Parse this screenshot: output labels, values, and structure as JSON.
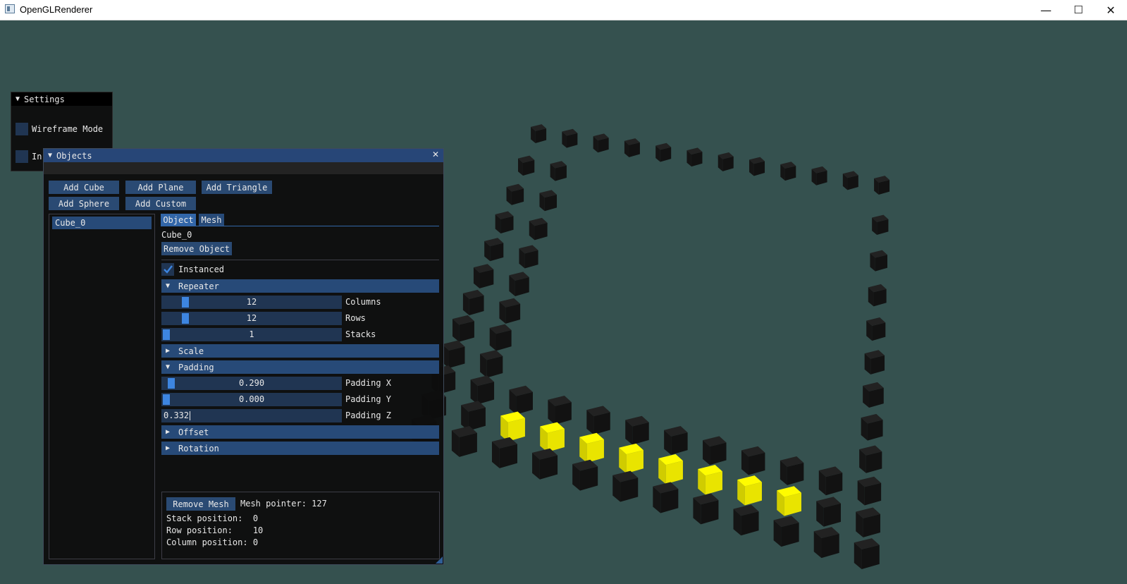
{
  "app": {
    "title": "OpenGLRenderer"
  },
  "window_controls": {
    "minimize": "—",
    "maximize": "☐",
    "close": "✕"
  },
  "colors": {
    "background": "#35514f",
    "cube": "#151515",
    "cube_selected": "#f5f000",
    "accent": "#3d85e0",
    "header": "#274a78",
    "button": "#2a4a73",
    "frame": "#203552"
  },
  "settings": {
    "title": "Settings",
    "wireframe_label": "Wireframe Mode",
    "second_label": "In"
  },
  "objects": {
    "title": "Objects",
    "close": "✕",
    "buttons": {
      "add_cube": "Add Cube",
      "add_plane": "Add Plane",
      "add_triangle": "Add Triangle",
      "add_sphere": "Add Sphere",
      "add_custom": "Add Custom"
    },
    "list": [
      "Cube_0"
    ],
    "tabs": [
      "Object",
      "Mesh"
    ],
    "selected_name": "Cube_0",
    "remove_object": "Remove Object",
    "instanced_label": "Instanced",
    "instanced_checked": true,
    "repeater": {
      "header": "Repeater",
      "columns": {
        "value": "12",
        "label": "Columns"
      },
      "rows": {
        "value": "12",
        "label": "Rows"
      },
      "stacks": {
        "value": "1",
        "label": "Stacks"
      }
    },
    "scale_header": "Scale",
    "padding": {
      "header": "Padding",
      "x": {
        "value": "0.290",
        "label": "Padding X"
      },
      "y": {
        "value": "0.000",
        "label": "Padding Y"
      },
      "z": {
        "value": "0.332",
        "label": "Padding Z"
      }
    },
    "offset_header": "Offset",
    "rotation_header": "Rotation",
    "mesh_info": {
      "remove_mesh": "Remove Mesh",
      "mesh_pointer": "Mesh pointer: 127",
      "stack": "Stack position:  0",
      "row": "Row position:    10",
      "column": "Column position: 0"
    }
  },
  "scene": {
    "description_icons": [
      "cube-instance"
    ],
    "cube_grid": {
      "columns": 12,
      "rows": 12,
      "highlighted_row": 10
    }
  }
}
